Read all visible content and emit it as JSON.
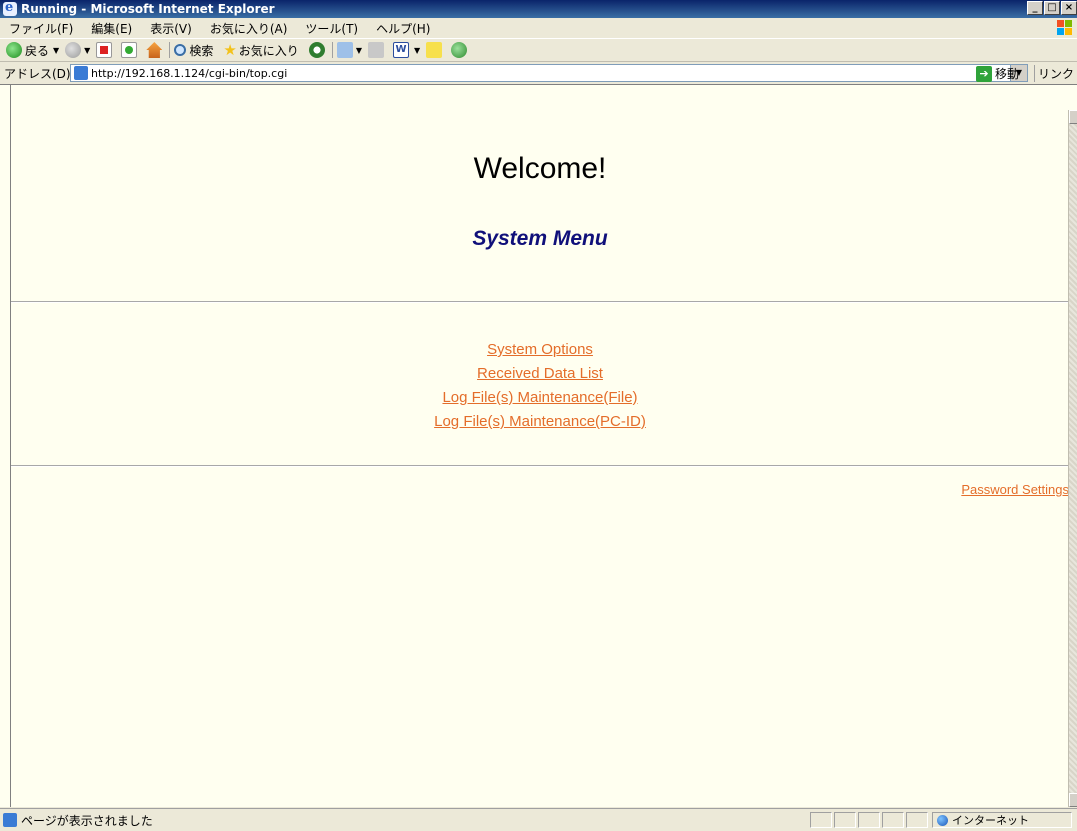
{
  "window": {
    "title": "Running - Microsoft Internet Explorer"
  },
  "menubar": {
    "items": [
      "ファイル(F)",
      "編集(E)",
      "表示(V)",
      "お気に入り(A)",
      "ツール(T)",
      "ヘルプ(H)"
    ]
  },
  "toolbar": {
    "back_label": "戻る",
    "search_label": "検索",
    "favorites_label": "お気に入り"
  },
  "addressbar": {
    "label": "アドレス(D)",
    "url": "http://192.168.1.124/cgi-bin/top.cgi",
    "go_label": "移動",
    "links_label": "リンク"
  },
  "page": {
    "heading": "Welcome!",
    "subheading": "System Menu",
    "links": [
      "System Options",
      "Received Data List",
      "Log File(s) Maintenance(File)",
      "Log File(s) Maintenance(PC-ID)"
    ],
    "password_link": "Password Settings"
  },
  "statusbar": {
    "text": "ページが表示されました",
    "zone": "インターネット"
  },
  "colors": {
    "link": "#e46d2a",
    "subheading": "#10107a",
    "page_bg": "#fffff0"
  }
}
